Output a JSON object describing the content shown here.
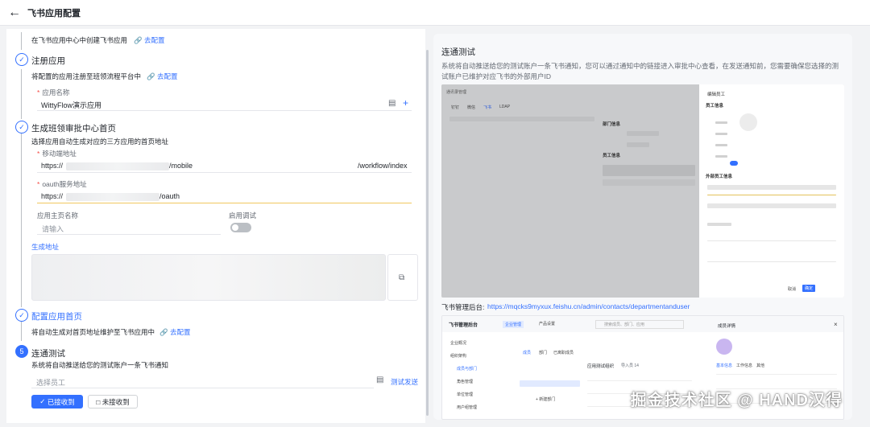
{
  "header": {
    "back_icon": "arrow-left-icon",
    "title": "飞书应用配置"
  },
  "steps": {
    "intro_text": "在飞书应用中心中创建飞书应用",
    "intro_link": "去配置",
    "register": {
      "title": "注册应用",
      "desc": "将配置的应用注册至班领流程平台中",
      "link": "去配置",
      "app_name_label": "应用名称",
      "app_name_value": "WittyFlow演示应用"
    },
    "homepage": {
      "title": "生成班领审批中心首页",
      "desc": "选择应用自动生成对应的三方应用的首页地址",
      "mobile_label": "移动端地址",
      "mobile_prefix": "https://",
      "mobile_mid": "/mobile",
      "mobile_suffix": "/workflow/index",
      "oauth_label": "oauth服务地址",
      "oauth_prefix": "https://",
      "oauth_suffix": "/oauth",
      "page_name_label": "应用主页名称",
      "page_name_placeholder": "请输入",
      "debug_label": "启用调试",
      "generate_link": "生成地址"
    },
    "config_home": {
      "title": "配置应用首页",
      "desc": "将自动生成对首页地址维护至飞书应用中",
      "link": "去配置"
    },
    "connect_test": {
      "number": "5",
      "title": "连通测试",
      "desc": "系统将自动推送给您的测试账户一条飞书通知",
      "employee_placeholder": "选择员工",
      "send_link": "测试发送",
      "received_btn": "已接收到",
      "not_received_btn": "未接收到"
    }
  },
  "right_panel": {
    "title": "连通测试",
    "desc": "系统将自动推送给您的测试账户一条飞书通知，您可以通过通知中的链接进入审批中心查看，在发送通知前，您需要确保您选择的测试账户已维护对应飞书的外部用户ID",
    "mock1": {
      "breadcrumb": "通讯录管理",
      "tabs": [
        "钉钉",
        "微信",
        "飞书",
        "LDAP"
      ],
      "dept_info": "部门信息",
      "staff_info": "员工信息",
      "edit_title": "编辑员工",
      "emp_info": "员工信息",
      "ext_info": "外部员工信息",
      "cancel": "取消",
      "confirm": "确定"
    },
    "admin_label": "飞书管理后台:",
    "admin_url": "https://mqcks9myxux.feishu.cn/admin/contacts/departmentanduser",
    "mock2": {
      "brand": "飞书管理后台",
      "nav1": "企业管理",
      "nav2": "产品设置",
      "search": "搜索成员、部门、应用",
      "menu": [
        "企业概况",
        "组织架构",
        "成员与部门",
        "角色管理",
        "单位管理",
        "用户组管理"
      ],
      "tabs": [
        "成员",
        "部门",
        "已离职成员"
      ],
      "dept_name": "应用测试组织",
      "member_count": "导入员 14",
      "add_dept": "+ 新建部门",
      "detail_title": "成员详情",
      "detail_tabs": [
        "基本信息",
        "工作信息",
        "其他"
      ]
    },
    "watermark": "掘金技术社区 @ HAND汉得"
  },
  "colors": {
    "primary": "#3370ff",
    "required": "#f54a45",
    "active_underline": "#f0c75e"
  }
}
